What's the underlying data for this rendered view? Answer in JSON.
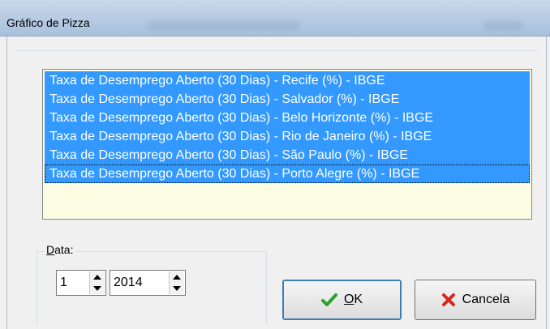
{
  "window": {
    "title": "Gráfico de Pizza"
  },
  "series_list": {
    "items": [
      "Taxa de Desemprego Aberto (30 Dias) - Recife (%) - IBGE",
      "Taxa de Desemprego Aberto (30 Dias) - Salvador (%) - IBGE",
      "Taxa de Desemprego Aberto (30 Dias) - Belo Horizonte (%) - IBGE",
      "Taxa de Desemprego Aberto (30 Dias) - Rio de Janeiro (%) - IBGE",
      "Taxa de Desemprego Aberto (30 Dias) - São Paulo (%) - IBGE",
      "Taxa de Desemprego Aberto (30 Dias) - Porto Alegre (%) - IBGE"
    ],
    "selection_color": "#3399ff",
    "background_color": "#fdfde4"
  },
  "date_group": {
    "label_underlined": "D",
    "label_rest": "ata:",
    "month_value": "1",
    "year_value": "2014"
  },
  "buttons": {
    "ok_underlined": "O",
    "ok_rest": "K",
    "ok_icon": "checkmark-icon",
    "cancel_label": "Cancela",
    "cancel_icon": "x-icon"
  }
}
